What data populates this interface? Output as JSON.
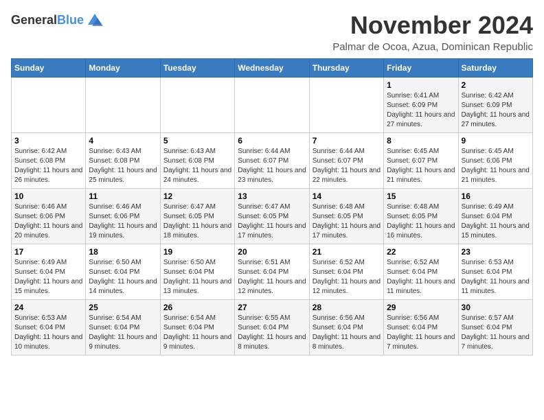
{
  "header": {
    "logo_line1": "General",
    "logo_line2": "Blue",
    "month_title": "November 2024",
    "location": "Palmar de Ocoa, Azua, Dominican Republic"
  },
  "weekdays": [
    "Sunday",
    "Monday",
    "Tuesday",
    "Wednesday",
    "Thursday",
    "Friday",
    "Saturday"
  ],
  "weeks": [
    [
      {
        "day": "",
        "detail": ""
      },
      {
        "day": "",
        "detail": ""
      },
      {
        "day": "",
        "detail": ""
      },
      {
        "day": "",
        "detail": ""
      },
      {
        "day": "",
        "detail": ""
      },
      {
        "day": "1",
        "detail": "Sunrise: 6:41 AM\nSunset: 6:09 PM\nDaylight: 11 hours and 27 minutes."
      },
      {
        "day": "2",
        "detail": "Sunrise: 6:42 AM\nSunset: 6:09 PM\nDaylight: 11 hours and 27 minutes."
      }
    ],
    [
      {
        "day": "3",
        "detail": "Sunrise: 6:42 AM\nSunset: 6:08 PM\nDaylight: 11 hours and 26 minutes."
      },
      {
        "day": "4",
        "detail": "Sunrise: 6:43 AM\nSunset: 6:08 PM\nDaylight: 11 hours and 25 minutes."
      },
      {
        "day": "5",
        "detail": "Sunrise: 6:43 AM\nSunset: 6:08 PM\nDaylight: 11 hours and 24 minutes."
      },
      {
        "day": "6",
        "detail": "Sunrise: 6:44 AM\nSunset: 6:07 PM\nDaylight: 11 hours and 23 minutes."
      },
      {
        "day": "7",
        "detail": "Sunrise: 6:44 AM\nSunset: 6:07 PM\nDaylight: 11 hours and 22 minutes."
      },
      {
        "day": "8",
        "detail": "Sunrise: 6:45 AM\nSunset: 6:07 PM\nDaylight: 11 hours and 21 minutes."
      },
      {
        "day": "9",
        "detail": "Sunrise: 6:45 AM\nSunset: 6:06 PM\nDaylight: 11 hours and 21 minutes."
      }
    ],
    [
      {
        "day": "10",
        "detail": "Sunrise: 6:46 AM\nSunset: 6:06 PM\nDaylight: 11 hours and 20 minutes."
      },
      {
        "day": "11",
        "detail": "Sunrise: 6:46 AM\nSunset: 6:06 PM\nDaylight: 11 hours and 19 minutes."
      },
      {
        "day": "12",
        "detail": "Sunrise: 6:47 AM\nSunset: 6:05 PM\nDaylight: 11 hours and 18 minutes."
      },
      {
        "day": "13",
        "detail": "Sunrise: 6:47 AM\nSunset: 6:05 PM\nDaylight: 11 hours and 17 minutes."
      },
      {
        "day": "14",
        "detail": "Sunrise: 6:48 AM\nSunset: 6:05 PM\nDaylight: 11 hours and 17 minutes."
      },
      {
        "day": "15",
        "detail": "Sunrise: 6:48 AM\nSunset: 6:05 PM\nDaylight: 11 hours and 16 minutes."
      },
      {
        "day": "16",
        "detail": "Sunrise: 6:49 AM\nSunset: 6:04 PM\nDaylight: 11 hours and 15 minutes."
      }
    ],
    [
      {
        "day": "17",
        "detail": "Sunrise: 6:49 AM\nSunset: 6:04 PM\nDaylight: 11 hours and 15 minutes."
      },
      {
        "day": "18",
        "detail": "Sunrise: 6:50 AM\nSunset: 6:04 PM\nDaylight: 11 hours and 14 minutes."
      },
      {
        "day": "19",
        "detail": "Sunrise: 6:50 AM\nSunset: 6:04 PM\nDaylight: 11 hours and 13 minutes."
      },
      {
        "day": "20",
        "detail": "Sunrise: 6:51 AM\nSunset: 6:04 PM\nDaylight: 11 hours and 12 minutes."
      },
      {
        "day": "21",
        "detail": "Sunrise: 6:52 AM\nSunset: 6:04 PM\nDaylight: 11 hours and 12 minutes."
      },
      {
        "day": "22",
        "detail": "Sunrise: 6:52 AM\nSunset: 6:04 PM\nDaylight: 11 hours and 11 minutes."
      },
      {
        "day": "23",
        "detail": "Sunrise: 6:53 AM\nSunset: 6:04 PM\nDaylight: 11 hours and 11 minutes."
      }
    ],
    [
      {
        "day": "24",
        "detail": "Sunrise: 6:53 AM\nSunset: 6:04 PM\nDaylight: 11 hours and 10 minutes."
      },
      {
        "day": "25",
        "detail": "Sunrise: 6:54 AM\nSunset: 6:04 PM\nDaylight: 11 hours and 9 minutes."
      },
      {
        "day": "26",
        "detail": "Sunrise: 6:54 AM\nSunset: 6:04 PM\nDaylight: 11 hours and 9 minutes."
      },
      {
        "day": "27",
        "detail": "Sunrise: 6:55 AM\nSunset: 6:04 PM\nDaylight: 11 hours and 8 minutes."
      },
      {
        "day": "28",
        "detail": "Sunrise: 6:56 AM\nSunset: 6:04 PM\nDaylight: 11 hours and 8 minutes."
      },
      {
        "day": "29",
        "detail": "Sunrise: 6:56 AM\nSunset: 6:04 PM\nDaylight: 11 hours and 7 minutes."
      },
      {
        "day": "30",
        "detail": "Sunrise: 6:57 AM\nSunset: 6:04 PM\nDaylight: 11 hours and 7 minutes."
      }
    ]
  ]
}
